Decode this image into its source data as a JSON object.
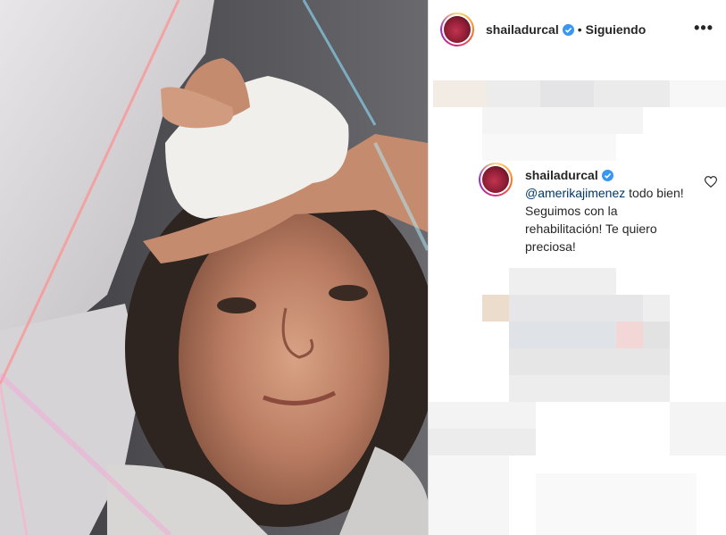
{
  "post": {
    "username": "shailadurcal",
    "separator": "•",
    "follow_status": "Siguiendo",
    "more_icon": "•••"
  },
  "comment": {
    "username": "shailadurcal",
    "mention": "@amerikajimenez",
    "text": " todo bien! Seguimos con la rehabilitación! Te quiero preciosa!"
  },
  "colors": {
    "text": "#262626",
    "verified": "#3897f0",
    "mention": "#00376b",
    "border": "#dbdbdb"
  }
}
